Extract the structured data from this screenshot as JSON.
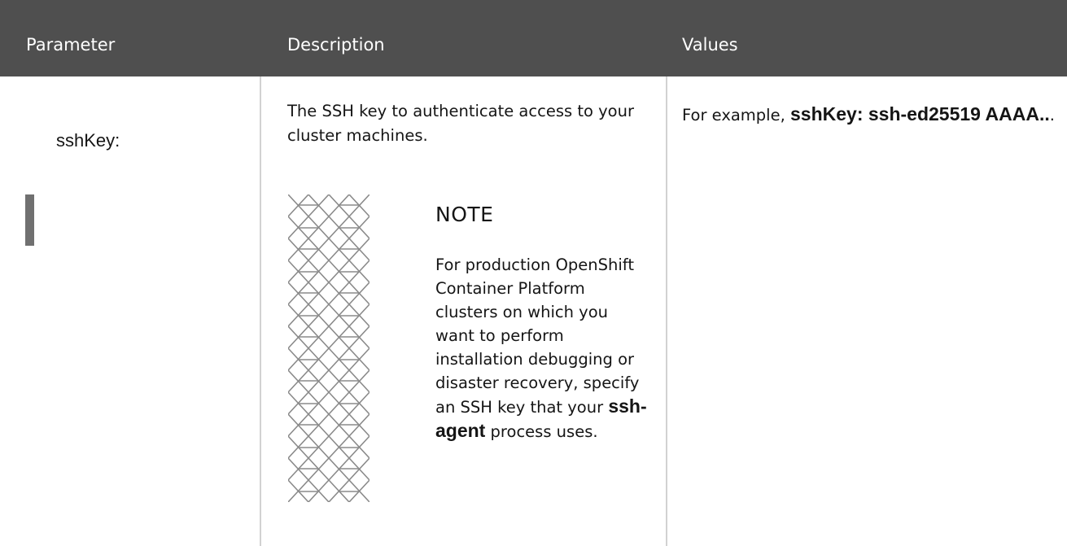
{
  "table": {
    "headers": {
      "parameter": "Parameter",
      "description": "Description",
      "values": "Values"
    },
    "row": {
      "parameter": "sshKey:",
      "description": "The SSH key to authenticate access to your cluster machines.",
      "note": {
        "title": "NOTE",
        "text_before": "For production OpenShift Container Platform clusters on which you want to perform installation debugging or disaster recovery, specify an SSH key that your",
        "code": "ssh-agent",
        "text_after": " process uses."
      },
      "values": {
        "prefix": "For example, ",
        "code": "sshKey: ssh-ed25519 AAAA..",
        "suffix": "."
      }
    }
  },
  "colors": {
    "header_bg": "#4f4f4f",
    "header_text": "#ffffff",
    "divider": "#d2d2d2",
    "param_bar": "#707070"
  },
  "icons": {
    "note": "note-pattern-icon"
  }
}
